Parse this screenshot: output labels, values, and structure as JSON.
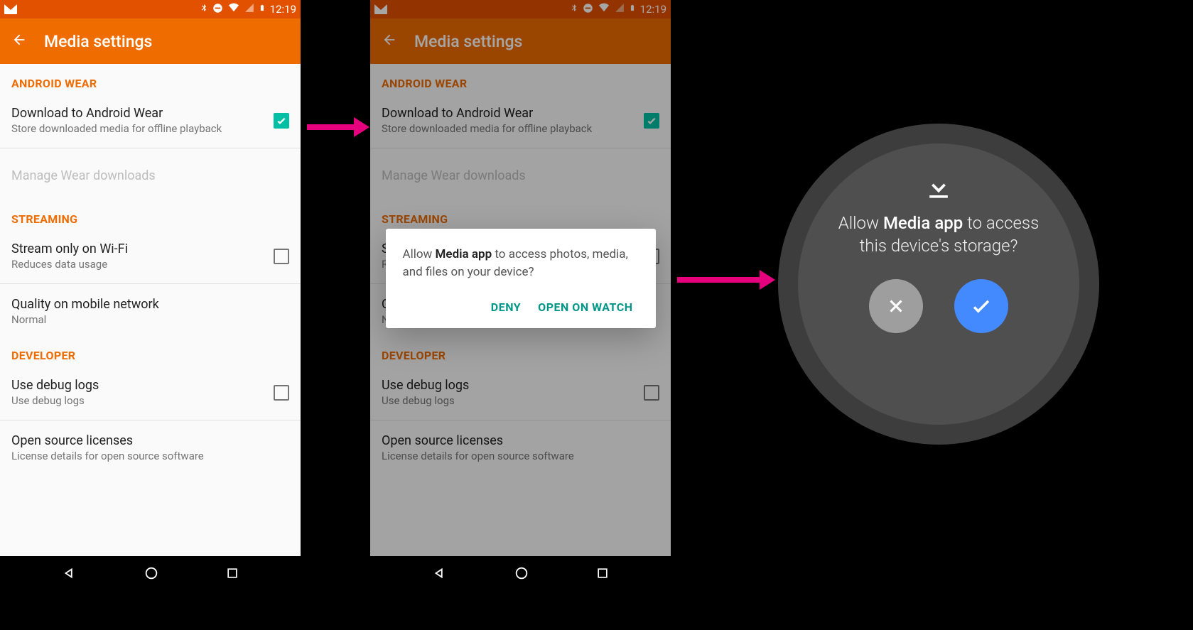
{
  "status": {
    "time": "12:19"
  },
  "appbar": {
    "title": "Media settings"
  },
  "sections": {
    "wear_header": "ANDROID WEAR",
    "download_wear": {
      "title": "Download to Android Wear",
      "sub": "Store downloaded media for offline playback"
    },
    "manage_wear": {
      "title": "Manage Wear downloads"
    },
    "streaming_header": "STREAMING",
    "stream_wifi": {
      "title": "Stream only on Wi-Fi",
      "sub": "Reduces data usage"
    },
    "quality": {
      "title": "Quality on mobile network",
      "sub": "Normal"
    },
    "developer_header": "DEVELOPER",
    "debug": {
      "title": "Use debug logs",
      "sub": "Use debug logs"
    },
    "oss": {
      "title": "Open source licenses",
      "sub": "License details for open source software"
    }
  },
  "dialog": {
    "prefix": "Allow ",
    "app": "Media app",
    "suffix": " to access photos, media, and files on your device?",
    "deny": "DENY",
    "open": "OPEN ON WATCH"
  },
  "watch": {
    "prefix": "Allow ",
    "app": "Media app",
    "suffix": "  to access this device's storage?"
  }
}
